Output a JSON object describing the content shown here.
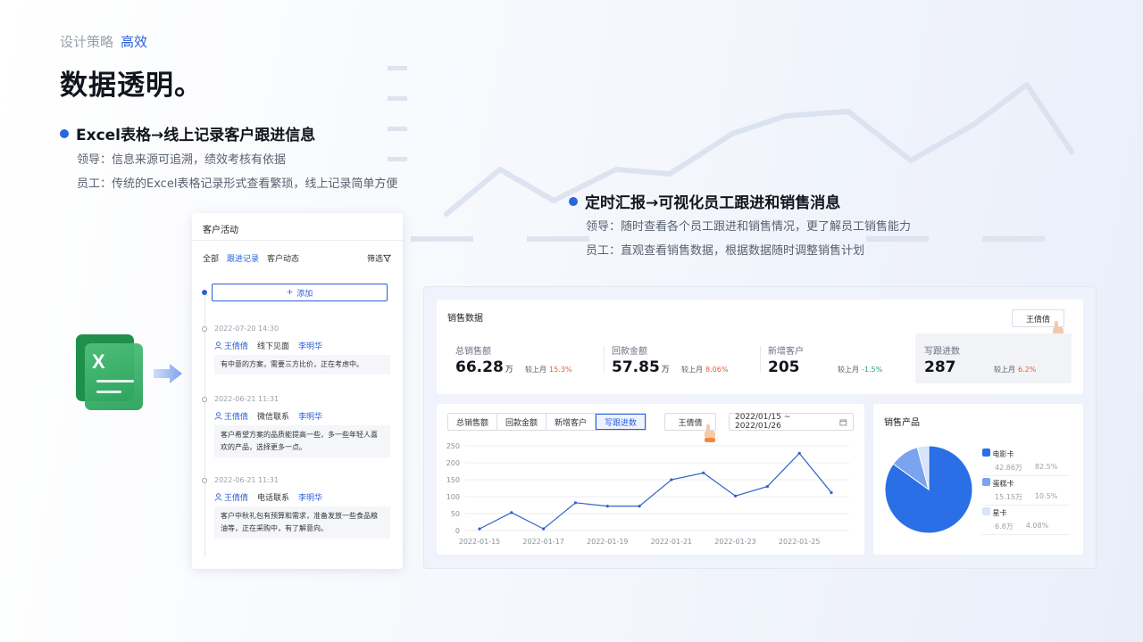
{
  "header": {
    "eyebrow": "设计策略",
    "eyebrow_accent": "高效",
    "title": "数据透明。"
  },
  "point1": {
    "heading": "Excel表格→线上记录客户跟进信息",
    "lines": [
      "领导：信息来源可追溯，绩效考核有依据",
      "员工：传统的Excel表格记录形式查看繁琐，线上记录简单方便"
    ]
  },
  "point2": {
    "heading": "定时汇报→可视化员工跟进和销售消息",
    "lines": [
      "领导：随时查看各个员工跟进和销售情况，更了解员工销售能力",
      "员工：直观查看销售数据，根据数据随时调整销售计划"
    ]
  },
  "activity": {
    "title": "客户活动",
    "tabs": [
      "全部",
      "跟进记录",
      "客户动态"
    ],
    "active_tab": "跟进记录",
    "filter_label": "筛选",
    "add_label": "添加",
    "entries": [
      {
        "date": "2022-07-20 14:30",
        "owner": "王倩倩",
        "type": "线下见面",
        "customer": "李明华",
        "note": "有中意的方案，需要三方比价，正在考虑中。"
      },
      {
        "date": "2022-06-21 11:31",
        "owner": "王倩倩",
        "type": "微信联系",
        "customer": "李明华",
        "note": "客户希望方案的品质能提高一些，多一些年轻人喜欢的产品，选择更多一点。"
      },
      {
        "date": "2022-06-21 11:31",
        "owner": "王倩倩",
        "type": "电话联系",
        "customer": "李明华",
        "note": "客户中秋礼包有预算和需求，准备发放一些食品粮油等，正在采购中，有了解意向。"
      }
    ]
  },
  "excel_icon": {
    "glyph": "X"
  },
  "sales": {
    "title": "销售数据",
    "person": "王倩倩",
    "compare_label": "较上月",
    "stats": [
      {
        "label": "总销售额",
        "value": "66.28",
        "unit": "万",
        "change": "15.3%",
        "trend": "up"
      },
      {
        "label": "回款金额",
        "value": "57.85",
        "unit": "万",
        "change": "8.06%",
        "trend": "up"
      },
      {
        "label": "新增客户",
        "value": "205",
        "unit": "",
        "change": "-1.5%",
        "trend": "down"
      },
      {
        "label": "写跟进数",
        "value": "287",
        "unit": "",
        "change": "6.2%",
        "trend": "up"
      }
    ]
  },
  "trend": {
    "tabs": [
      "总销售额",
      "回款金额",
      "新增客户",
      "写跟进数"
    ],
    "active_tab": "写跟进数",
    "person": "王倩倩",
    "date_range": "2022/01/15  ~  2022/01/26"
  },
  "products": {
    "title": "销售产品",
    "items": [
      {
        "name": "电影卡",
        "amount": "42.86万",
        "pct": "82.5%",
        "value": 82.5,
        "color": "#2b6fe6"
      },
      {
        "name": "蛋糕卡",
        "amount": "15.15万",
        "pct": "10.5%",
        "value": 10.5,
        "color": "#7aa3f0"
      },
      {
        "name": "星卡",
        "amount": "6.8万",
        "pct": "4.08%",
        "value": 4.08,
        "color": "#d7e4fb"
      }
    ]
  },
  "chart_data": [
    {
      "type": "line",
      "x": [
        "2022-01-15",
        "2022-01-16",
        "2022-01-17",
        "2022-01-18",
        "2022-01-19",
        "2022-01-20",
        "2022-01-21",
        "2022-01-22",
        "2022-01-23",
        "2022-01-24",
        "2022-01-25",
        "2022-01-26"
      ],
      "x_tick_labels": [
        "2022-01-15",
        "2022-01-17",
        "2022-01-19",
        "2022-01-21",
        "2022-01-23",
        "2022-01-25"
      ],
      "series": [
        {
          "values": [
            5,
            53,
            5,
            82,
            72,
            72,
            150,
            170,
            102,
            130,
            228,
            112
          ]
        }
      ],
      "yticks": [
        0,
        50,
        100,
        150,
        200,
        250
      ],
      "ylim": [
        0,
        250
      ],
      "grid": true,
      "color": "#2f64c8"
    },
    {
      "type": "pie",
      "categories": [
        "电影卡",
        "蛋糕卡",
        "星卡"
      ],
      "values": [
        82.5,
        10.5,
        4.08
      ],
      "legend": "right"
    }
  ]
}
